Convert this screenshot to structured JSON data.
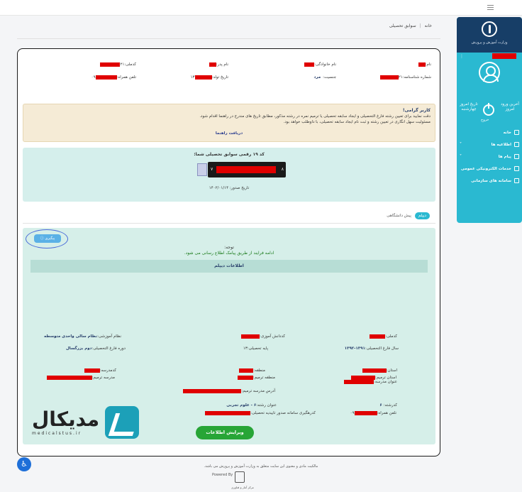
{
  "breadcrumb": {
    "home": "خانه",
    "sep": "|",
    "current": "سوابق تحصیلی"
  },
  "sidebar": {
    "org": "وزارت آموزش و پرورش",
    "quick_right": "آخرین ورود",
    "quick_right_sub": "امروز",
    "quick_left": "تاریخ امروز",
    "quick_left_sub": "چهارشنبه",
    "exit": "خروج",
    "items": [
      {
        "label": "خانه",
        "icon": "home-icon"
      },
      {
        "label": "اطلاعیه ها",
        "icon": "bell-icon"
      },
      {
        "label": "پیام ها",
        "icon": "mail-icon"
      },
      {
        "label": "خدمات الکترونیکی عمومی",
        "icon": "grid-icon"
      },
      {
        "label": "سامانه های سازمانی",
        "icon": "grid-icon"
      }
    ]
  },
  "profile": {
    "name_label": "نام:",
    "family_label": "نام خانوادگی:",
    "father_label": "نام پدر:",
    "national_label": "کدملی:",
    "shenas_label": "شماره شناسنامه:",
    "shenas_suffix": "۲۱",
    "gender_label": "جنسیت:",
    "gender": "مرد",
    "birth_label": "تاریخ تولد:",
    "birth_suffix": "۱۳",
    "phone_label": "تلفن همراه:",
    "phone_prefix": "۰۹"
  },
  "notice": {
    "greeting": "کاربر گرامی!",
    "line1": "دقت نمایید برای تعیین رشته فارغ التحصیلی و ایجاد سابقه تحصیلی یا ترمیم نمره در رشته مذکور، مطابق تاریخ های مندرج در راهنما اقدام شود.",
    "line2": "مسئولیت سهل انگاری در تعیین رشته و ثبت نام ایجاد سابقه تحصیلی، با داوطلب خواهد بود.",
    "guide": "دریافت راهنما"
  },
  "tracking": {
    "title": "کد ۱۹ رقمی سوابق تحصیلی شما:",
    "code_start": "۷",
    "code_end": "۸",
    "date": "تاریخ صدور: ۱۴۰۲/۰۱/۱۴"
  },
  "tabs": {
    "active": "دیپلم",
    "other": "پیش دانشگاهی"
  },
  "diploma": {
    "track_button": "پیگیری",
    "attention": "توجه:",
    "attention_msg": "ادامه فرایند از طریق پیامک اطلاع رسانی می شود.",
    "section_title": "اطلاعات دیپلم",
    "national_code": "کدملی:",
    "school_code": "کددانش آموزی:",
    "school_name": "نظام آموزشی:",
    "school_name_val": "نظام سالی واحدی متوسطه",
    "grad_year": "سال فارغ التحصیلی:",
    "grad_year_val": "۱۳۹۲-۱۳۹۱",
    "grade": "پایه تحصیلی:",
    "grade_val": "۱۳",
    "course": "دوره فارغ التحصیلی:",
    "course_val": "دوم بزرگسال",
    "province": "استان:",
    "region": "منطقه:",
    "school_code2": "کدمدرسه:",
    "school_title": "عنوان مدرسه:",
    "field_code": "کدرشته:",
    "field_code_val": "۶",
    "field_title": "عنوان رشته:",
    "field_title_val": "۶ - علوم تجربی",
    "province_repair": "استان ترمیم:",
    "region_repair": "منطقه ترمیم:",
    "school_repair": "مدرسه ترمیم:",
    "address_repair": "آدرس مدرسه ترمیم:",
    "mobile": "تلفن همراه:",
    "mobile_prefix": "۰۹",
    "postal": "کدرهگیری سامانه صدور تاییدیه تحصیلی:",
    "edit_button": "ویرایش اطلاعات"
  },
  "watermark": {
    "brand": "مدیکال",
    "site": "medicalstus.ir"
  },
  "footer": {
    "text": "مالکیت مادی و معنوی این سایت متعلق به وزارت آموزش و پرورش می باشد.",
    "powered": "Powered By",
    "maker": "مرکز آمار و فناوری"
  },
  "colors": {
    "accent": "#2ab9d1",
    "sidebar_head": "#173e67",
    "red_mask": "#e00000",
    "green": "#27a536"
  }
}
